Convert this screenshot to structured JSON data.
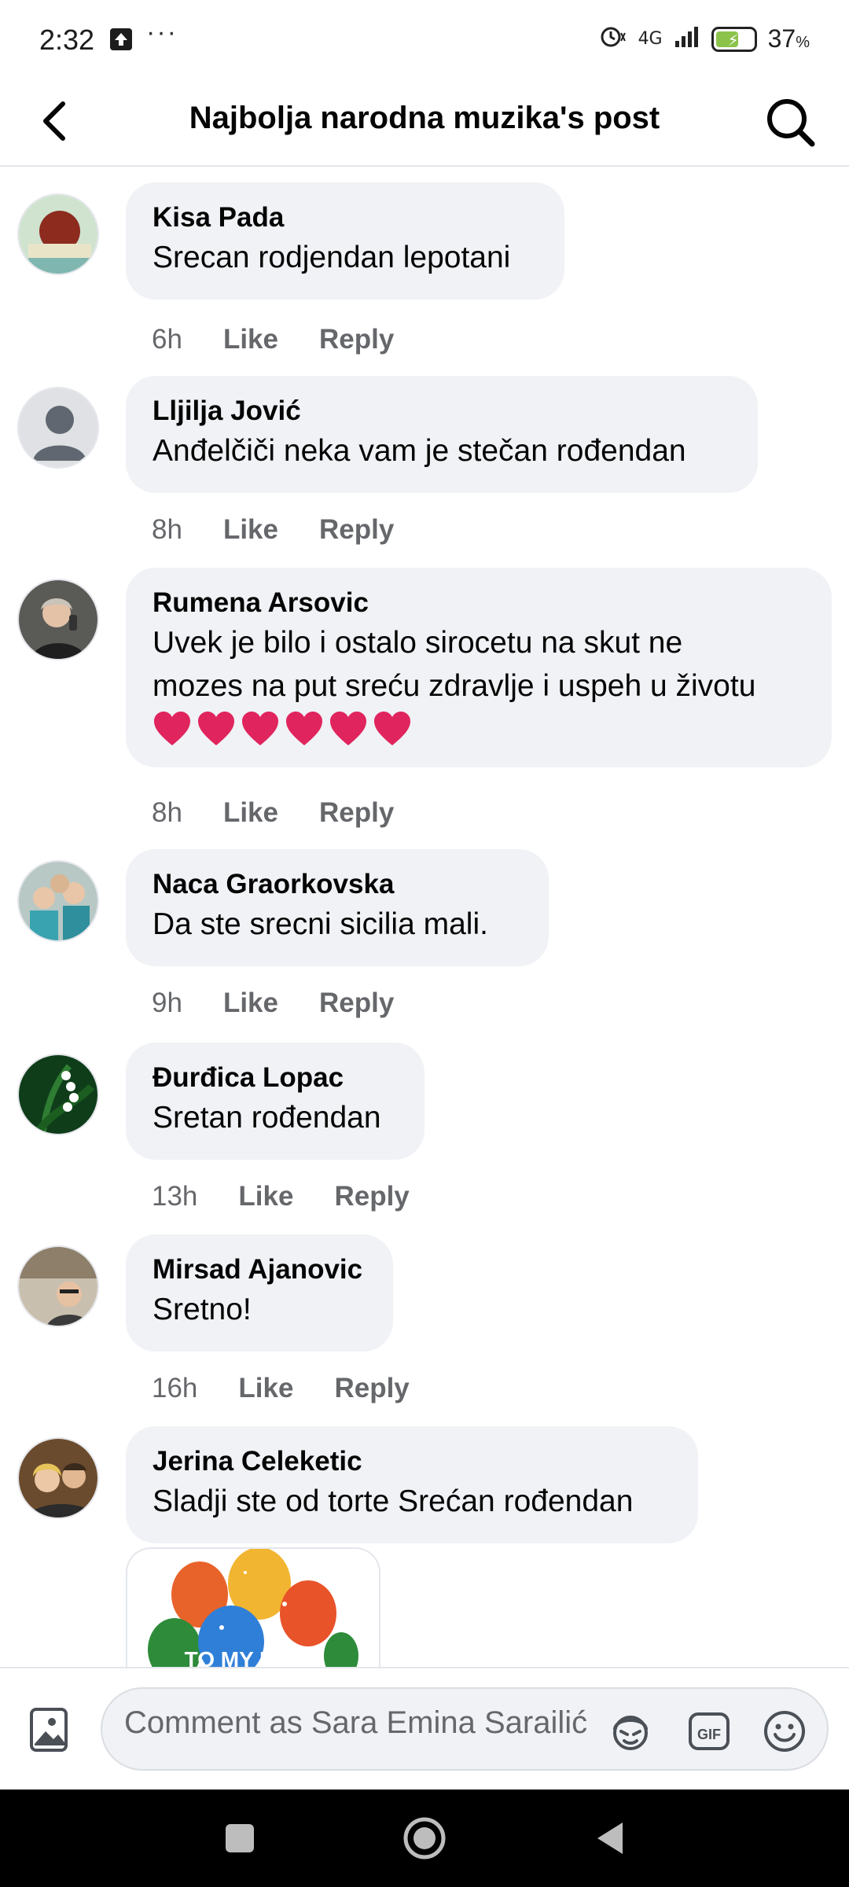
{
  "status_bar": {
    "time": "2:32",
    "more": "···",
    "network": "4G",
    "battery_percent": "37",
    "battery_unit": "%",
    "battery_level": 0.37
  },
  "header": {
    "title": "Najbolja narodna muzika's post"
  },
  "comments": [
    {
      "author": "Kisa Pada",
      "text": "Srecan rodjendan lepotani",
      "time": "6h",
      "like": "Like",
      "reply": "Reply"
    },
    {
      "author": "Lljilja Jović",
      "text": "Anđelčiči neka vam je stečan rođendan",
      "time": "8h",
      "like": "Like",
      "reply": "Reply"
    },
    {
      "author": "Rumena Arsovic",
      "text_line1": "Uvek je bilo i ostalo sirocetu na skut ne",
      "text_line2": "mozes na put sreću zdravlje i uspeh u životu",
      "hearts": 6,
      "time": "8h",
      "like": "Like",
      "reply": "Reply"
    },
    {
      "author": "Naca Graorkovska",
      "text": "Da ste srecni sicilia mali.",
      "time": "9h",
      "like": "Like",
      "reply": "Reply"
    },
    {
      "author": "Đurđica Lopac",
      "text": "Sretan rođendan",
      "time": "13h",
      "like": "Like",
      "reply": "Reply"
    },
    {
      "author": "Mirsad Ajanovic",
      "text": "Sretno!",
      "time": "16h",
      "like": "Like",
      "reply": "Reply"
    },
    {
      "author": "Jerina Celeketic",
      "text": "Sladji ste od torte Srećan rođendan",
      "sticker_text": "TO MY BABY"
    }
  ],
  "composer": {
    "placeholder": "Comment as Sara Emina Sarailić"
  },
  "colors": {
    "bubble": "#f0f2f5",
    "secondary_text": "#65676b",
    "heart": "#e0245e",
    "battery": "#8bc34a"
  },
  "icons": [
    "back-arrow-icon",
    "search-icon",
    "photo-icon",
    "avatar-sticker-icon",
    "gif-icon",
    "emoji-icon",
    "heart-icon"
  ]
}
